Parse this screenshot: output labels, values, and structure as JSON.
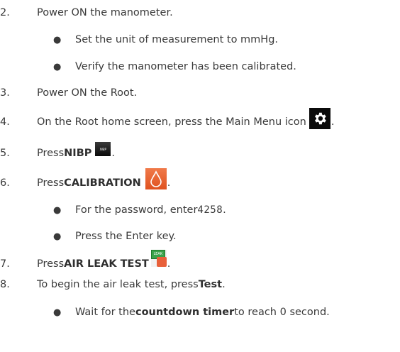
{
  "steps": [
    {
      "num": "2.",
      "text": "Power ON the manometer."
    },
    {
      "bullet": "Set the unit of measurement to mmHg."
    },
    {
      "bullet": "Verify the manometer has been calibrated."
    },
    {
      "num": "3.",
      "text": "Power ON the Root."
    },
    {
      "num": "4.",
      "text": "On the Root home screen, press the Main Menu icon",
      "icon": "gear-icon",
      "suffix": "."
    },
    {
      "num": "5.",
      "prefix": "Press ",
      "bold": "NIBP",
      "icon": "nibp-icon",
      "icon_text": "NIBP",
      "suffix": "."
    },
    {
      "num": "6.",
      "prefix": "Press ",
      "bold": "CALIBRATION",
      "icon": "calibration-icon",
      "suffix": "."
    },
    {
      "bullet_prefix": "For the password, enter ",
      "code": "4258",
      "bullet_suffix": "."
    },
    {
      "bullet": "Press the Enter key."
    },
    {
      "num": "7.",
      "prefix": "Press ",
      "bold": "AIR LEAK TEST",
      "icon": "air-leak-test-icon",
      "icon_text": "LEAK",
      "suffix": "."
    },
    {
      "num": "8.",
      "prefix": "To begin the air leak test, press ",
      "bold": "Test",
      "suffix": "."
    },
    {
      "bullet_prefix": "Wait for the ",
      "bullet_bold": "countdown timer",
      "bullet_suffix": " to reach 0 second."
    }
  ],
  "colors": {
    "text": "#3a3a3a",
    "gear_bg": "#0b0b0b",
    "calibration_bg": "#e8603a",
    "leak_tag": "#3aa24a"
  }
}
